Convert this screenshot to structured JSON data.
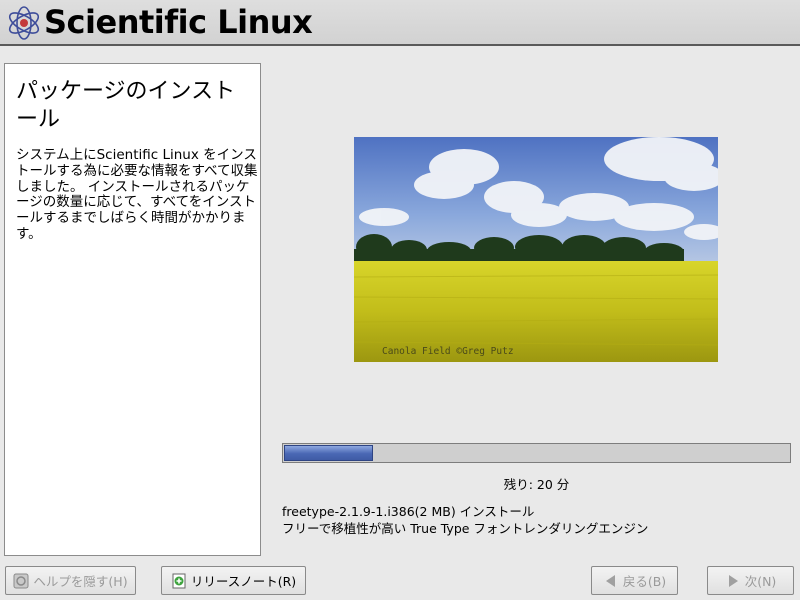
{
  "header": {
    "title": "Scientific Linux",
    "logo_icon": "atom-logo-icon"
  },
  "help": {
    "title": "パッケージのインストール",
    "body": "システム上にScientific Linux をインストールする為に必要な情報をすべて収集しました。 インストールされるパッケージの数量に応じて、すべてをインストールするまでしばらく時間がかかります。"
  },
  "photo": {
    "caption": "Canola Field ©Greg Putz"
  },
  "progress": {
    "fraction": 0.175
  },
  "status": {
    "remaining": "残り: 20 分",
    "package": "freetype-2.1.9-1.i386(2 MB) インストール",
    "description": "フリーで移植性が高い True Type フォントレンダリングエンジン"
  },
  "buttons": {
    "hide_help": "ヘルプを隠す(H)",
    "release_notes": "リリースノート(R)",
    "back": "戻る(B)",
    "next": "次(N)"
  },
  "colors": {
    "progress_fill": "#4a67b4",
    "header_bg": "#d8d8d8",
    "window_bg": "#e9e9e9"
  }
}
